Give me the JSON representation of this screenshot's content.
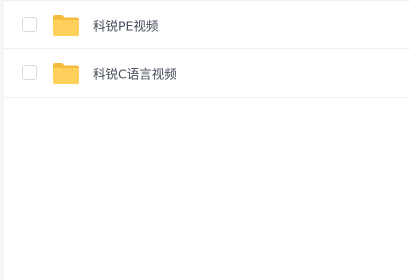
{
  "files": [
    {
      "name": "科锐PE视频",
      "type": "folder-icon",
      "checked": false
    },
    {
      "name": "科锐C语言视频",
      "type": "folder-icon",
      "checked": false
    }
  ],
  "colors": {
    "folder": "#ffd15c",
    "folder_tab": "#f5bd3e",
    "text": "#454d5a",
    "divider": "#eef0f3"
  }
}
